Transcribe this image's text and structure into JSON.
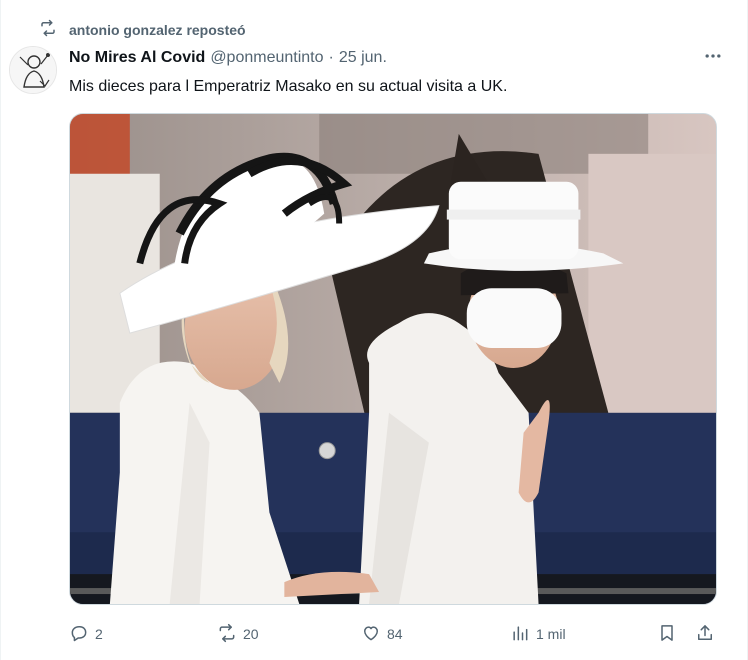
{
  "repost": {
    "icon": "repost-icon",
    "text": "antonio gonzalez reposteó"
  },
  "tweet": {
    "display_name": "No Mires Al Covid",
    "handle": "@ponmeuntinto",
    "separator": "·",
    "date": "25 jun.",
    "text": "Mis dieces para l Emperatriz Masako en su actual visita a UK.",
    "more_icon": "more-icon"
  },
  "media": {
    "icon": "photo",
    "dominant_colors": [
      "#f4f2f0",
      "#1c1c1c",
      "#c8bfb9",
      "#2c3c64"
    ]
  },
  "actions": {
    "reply_count": "2",
    "repost_count": "20",
    "like_count": "84",
    "views_count": "1 mil"
  },
  "colors": {
    "text": "#0f1419",
    "secondary": "#536471",
    "border": "#cfd9de"
  }
}
